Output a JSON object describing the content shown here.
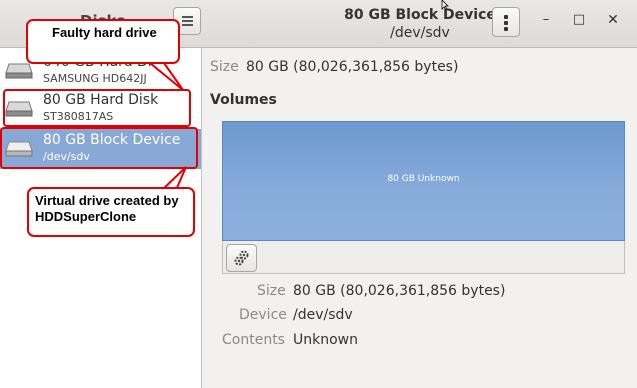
{
  "app": {
    "title": "Disks"
  },
  "window": {
    "title": "80 GB Block Device",
    "subtitle": "/dev/sdv",
    "buttons": {
      "minimize": "–",
      "maximize": "□",
      "close": "✕"
    }
  },
  "sidebar": {
    "devices": [
      {
        "name": "640 GB Hard Disk",
        "sub": "SAMSUNG HD642JJ",
        "icon": "hard-disk-icon"
      },
      {
        "name": "80 GB Hard Disk",
        "sub": "ST380817AS",
        "icon": "hard-disk-icon"
      },
      {
        "name": "80 GB Block Device",
        "sub": "/dev/sdv",
        "icon": "block-device-icon",
        "selected": true
      }
    ]
  },
  "main": {
    "size_label": "Size",
    "size_value": "80 GB (80,026,361,856 bytes)",
    "volumes_heading": "Volumes",
    "volume": {
      "label": "80 GB Unknown"
    },
    "details": [
      {
        "label": "Size",
        "value": "80 GB (80,026,361,856 bytes)"
      },
      {
        "label": "Device",
        "value": "/dev/sdv"
      },
      {
        "label": "Contents",
        "value": "Unknown"
      }
    ]
  },
  "annotations": {
    "faulty": "Faulty hard drive",
    "virtual_line1": "Virtual drive created by",
    "virtual_line2": "HDDSuperClone"
  },
  "colors": {
    "selection": "#88a8d5",
    "volume": "#7ba3d6",
    "annotation": "#e00000"
  }
}
